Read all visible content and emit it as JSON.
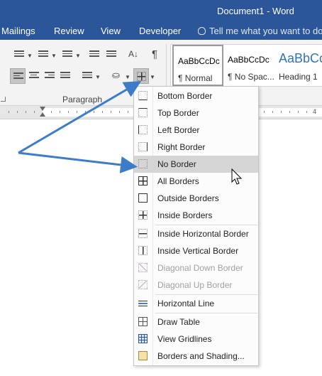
{
  "window": {
    "title": "Document1 - Word"
  },
  "tabs": [
    {
      "label": "Mailings"
    },
    {
      "label": "Review"
    },
    {
      "label": "View"
    },
    {
      "label": "Developer"
    }
  ],
  "tell_me": {
    "placeholder": "Tell me what you want to do..."
  },
  "paragraph_group": {
    "label": "Paragraph"
  },
  "styles": [
    {
      "sample": "AaBbCcDc",
      "name": "¶ Normal"
    },
    {
      "sample": "AaBbCcDc",
      "name": "¶ No Spac..."
    },
    {
      "sample": "AaBbCc",
      "name": "Heading 1"
    }
  ],
  "ruler": {
    "number": "4"
  },
  "border_menu": {
    "items": [
      {
        "label": "Bottom Border",
        "icon": "bottom-border-icon"
      },
      {
        "label": "Top Border",
        "icon": "top-border-icon"
      },
      {
        "label": "Left Border",
        "icon": "left-border-icon"
      },
      {
        "label": "Right Border",
        "icon": "right-border-icon"
      },
      {
        "label": "No Border",
        "icon": "no-border-icon",
        "highlighted": true
      },
      {
        "label": "All Borders",
        "icon": "all-borders-icon"
      },
      {
        "label": "Outside Borders",
        "icon": "outside-borders-icon"
      },
      {
        "label": "Inside Borders",
        "icon": "inside-borders-icon"
      },
      {
        "label": "Inside Horizontal Border",
        "icon": "inside-horizontal-border-icon"
      },
      {
        "label": "Inside Vertical Border",
        "icon": "inside-vertical-border-icon"
      },
      {
        "label": "Diagonal Down Border",
        "icon": "diagonal-down-border-icon",
        "disabled": true
      },
      {
        "label": "Diagonal Up Border",
        "icon": "diagonal-up-border-icon",
        "disabled": true
      },
      {
        "label": "Horizontal Line",
        "icon": "horizontal-line-icon"
      },
      {
        "label": "Draw Table",
        "icon": "draw-table-icon"
      },
      {
        "label": "View Gridlines",
        "icon": "view-gridlines-icon"
      },
      {
        "label": "Borders and Shading...",
        "icon": "borders-shading-icon"
      }
    ]
  },
  "colors": {
    "ribbon_blue": "#2b579a",
    "arrow_blue": "#3d7cc9",
    "highlight": "#d5d5d5"
  }
}
